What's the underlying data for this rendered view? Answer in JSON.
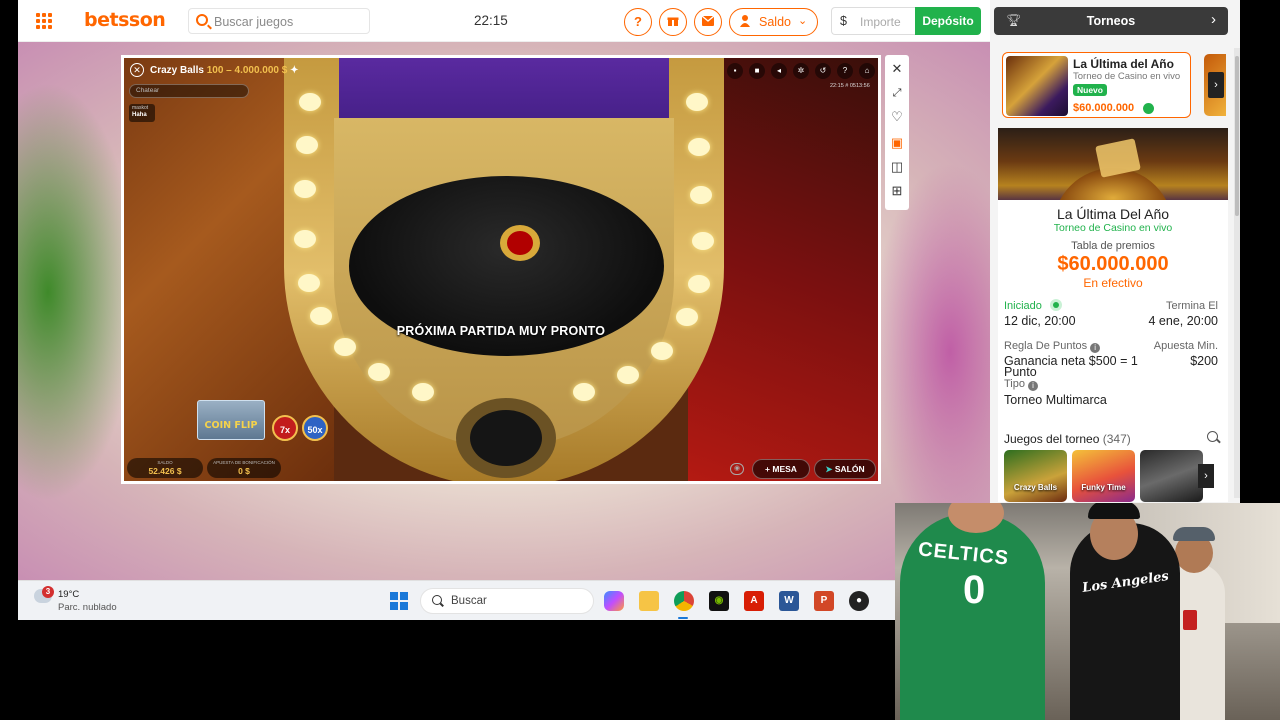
{
  "header": {
    "logo": "betsson",
    "search_placeholder": "Buscar juegos",
    "clock": "22:15",
    "help_icon": "?",
    "saldo_label": "Saldo",
    "currency_symbol": "$",
    "amount_placeholder": "Importe",
    "deposit_label": "Depósito"
  },
  "game": {
    "title": "Crazy Balls",
    "limits": "100 – 4.000.000 $",
    "chat_placeholder": "Chatear",
    "chat_message_user": "maskot",
    "chat_message_text": "Haha",
    "timestamp": "22:15 # 0513:56",
    "banner": "PRÓXIMA PARTIDA MUY PRONTO",
    "coinflip_label": "COIN FLIP",
    "mult_1": "7x",
    "mult_2": "50x",
    "balance_label": "SALDO",
    "balance_value": "52.426 $",
    "bonus_label": "APUESTA DE BONIFICACIÓN",
    "bonus_value": "0 $",
    "mesa_label": "MESA",
    "salon_label": "SALÓN"
  },
  "right_panel": {
    "torneos_label": "Torneos",
    "card": {
      "title": "La Última del Año",
      "subtitle": "Torneo de Casino en vivo",
      "badge": "Nuevo",
      "prize": "$60.000.000"
    },
    "detail": {
      "name": "La Última Del Año",
      "subtitle": "Torneo de Casino en vivo",
      "prize_table_label": "Tabla de premios",
      "prize": "$60.000.000",
      "prize_type": "En efectivo"
    },
    "stats": {
      "started_label": "Iniciado",
      "started_value": "12 dic, 20:00",
      "ends_label": "Termina El",
      "ends_value": "4 ene, 20:00",
      "points_rule_label": "Regla De Puntos",
      "points_rule_value_1": "Ganancia neta $500 = 1",
      "points_rule_value_2": "Punto",
      "min_bet_label": "Apuesta Min.",
      "min_bet_value": "$200",
      "type_label": "Tipo",
      "type_value": "Torneo Multimarca"
    },
    "games_title": "Juegos del torneo",
    "games_count": "(347)",
    "games": [
      "Crazy Balls",
      "Funky Time",
      ""
    ]
  },
  "taskbar": {
    "weather_badge": "3",
    "temperature": "19°C",
    "weather_desc": "Parc. nublado",
    "search_placeholder": "Buscar"
  },
  "webcam": {
    "jersey_text": "CELTICS",
    "jersey_number": "0",
    "shirt_text": "Los Angeles"
  },
  "colors": {
    "brand": "#ff6600",
    "deposit": "#21b24c",
    "dark_bar": "#3a3a3a"
  }
}
